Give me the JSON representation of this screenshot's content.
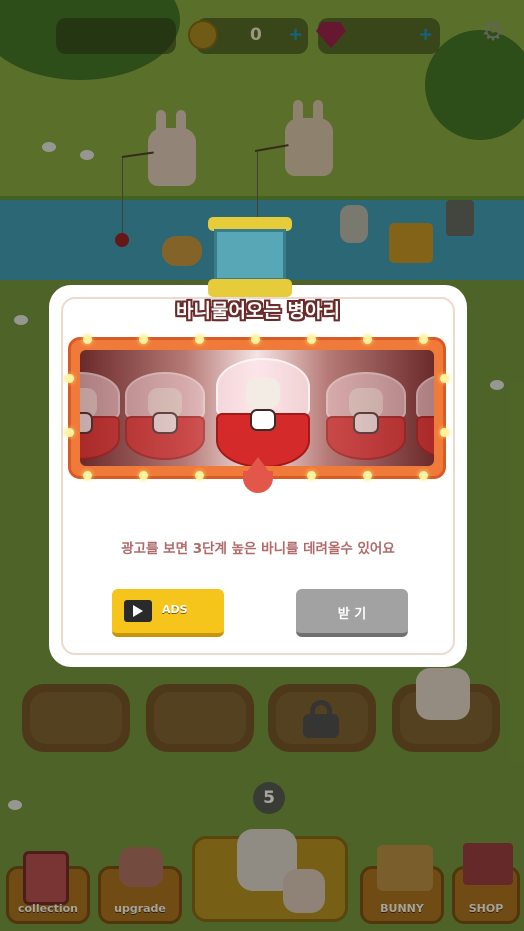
{
  "hud": {
    "coin_count": "0",
    "coin_plus": "+",
    "gem_plus": "+",
    "icons": [
      "coin-icon",
      "gem-icon",
      "settings-gear-icon"
    ]
  },
  "popup": {
    "title": "바니물어오는 병아리",
    "message": "광고를 보면 3단계 높은 바니를 데려올수 있어요",
    "ads_button_label": "ADS",
    "receive_button_label": "받 기",
    "accent_color": "#f07a3a",
    "ads_color": "#f5c51c",
    "receive_color": "#a2a2a2"
  },
  "bottom_bar": {
    "collection_label": "collection",
    "upgrade_label": "upgrade",
    "bunny_label": "BUNNY",
    "shop_label": "SHOP",
    "bunny_count": "5"
  }
}
